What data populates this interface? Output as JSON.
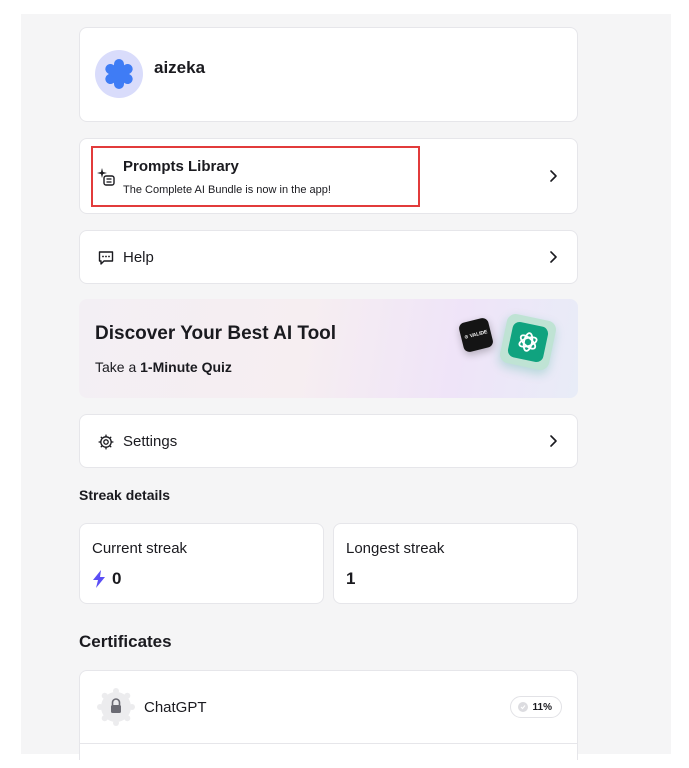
{
  "profile": {
    "username": "aizeka",
    "avatar_color": "#3f7cf5"
  },
  "prompts": {
    "title": "Prompts Library",
    "subtitle": "The Complete AI Bundle is now in the app!",
    "highlight_color": "#e23b3b"
  },
  "help": {
    "label": "Help"
  },
  "quiz": {
    "title": "Discover Your Best AI Tool",
    "sub_prefix": "Take a ",
    "sub_bold": "1-Minute Quiz",
    "tile_label": "⊙ VALIDE",
    "accent": "#10a37f"
  },
  "settings": {
    "label": "Settings"
  },
  "streak": {
    "heading": "Streak details",
    "current_label": "Current streak",
    "current_value": "0",
    "longest_label": "Longest streak",
    "longest_value": "1",
    "bolt_color": "#5b4ef5"
  },
  "certificates": {
    "heading": "Certificates",
    "items": [
      {
        "name": "ChatGPT",
        "progress": "11%"
      }
    ]
  },
  "icons": {
    "avatar": "asterisk-icon",
    "prompts": "sparkle-list-icon",
    "help": "chat-bubble-icon",
    "settings": "gear-icon",
    "chevron": "chevron-right-icon",
    "bolt": "lightning-icon",
    "lock": "lock-icon"
  }
}
